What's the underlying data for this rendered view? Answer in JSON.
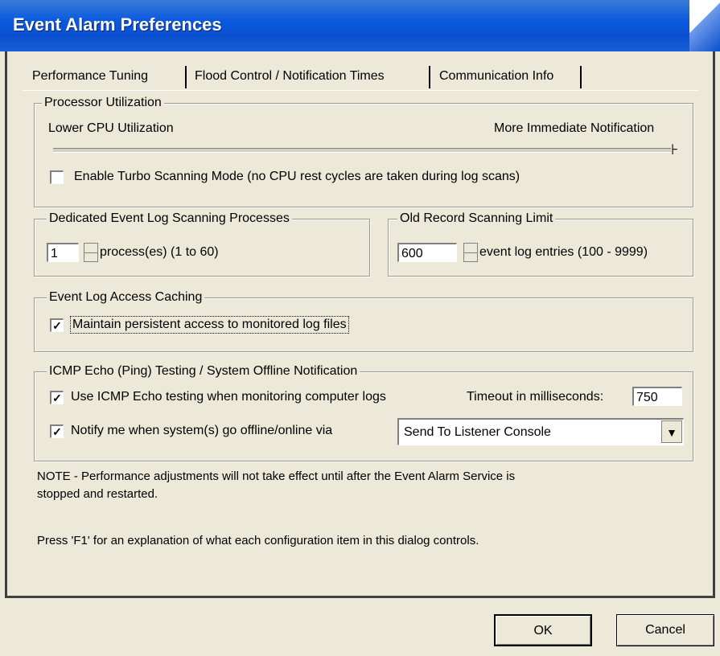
{
  "window": {
    "title": "Event Alarm Preferences"
  },
  "tabs": [
    {
      "label": "Performance Tuning"
    },
    {
      "label": "Flood Control / Notification Times"
    },
    {
      "label": "Communication Info"
    }
  ],
  "processor": {
    "legend": "Processor Utilization",
    "low_label": "Lower CPU Utilization",
    "high_label": "More Immediate Notification",
    "slider_fraction": 1.0,
    "turbo_label": "Enable Turbo Scanning Mode (no CPU rest cycles are taken during log scans)",
    "turbo_checked": false
  },
  "dedicated": {
    "legend": "Dedicated Event Log Scanning Processes",
    "value": "1",
    "suffix": "process(es) (1 to 60)"
  },
  "old_record": {
    "legend": "Old Record Scanning Limit",
    "value": "600",
    "suffix": "event log entries (100 - 9999)"
  },
  "caching": {
    "legend": "Event Log Access Caching",
    "persistent_label": "Maintain persistent access to monitored log files",
    "persistent_checked": true
  },
  "icmp": {
    "legend": "ICMP Echo (Ping) Testing / System Offline Notification",
    "use_icmp_label": "Use ICMP Echo testing when monitoring computer logs",
    "use_icmp_checked": true,
    "timeout_label": "Timeout in milliseconds:",
    "timeout_value": "750",
    "notify_label": "Notify me when system(s) go offline/online via",
    "notify_checked": true,
    "notify_select": "Send To Listener Console"
  },
  "notes": {
    "note1_line1": "NOTE - Performance adjustments will not take effect until after the Event Alarm Service is",
    "note1_line2": "stopped and restarted.",
    "note2": "Press 'F1' for an explanation of what each configuration item in this dialog controls."
  },
  "buttons": {
    "ok": "OK",
    "cancel": "Cancel"
  }
}
